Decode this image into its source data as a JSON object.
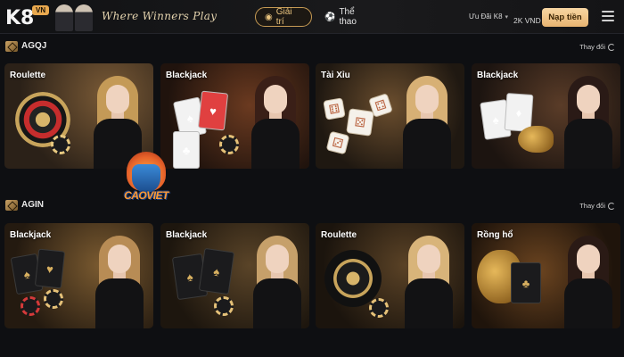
{
  "header": {
    "logo_text": "K8",
    "logo_badge": "VN",
    "slogan": "Where Winners Play",
    "nav": [
      {
        "label": "Giải trí",
        "icon": "gamepad-icon",
        "active": true
      },
      {
        "label": "Thể thao",
        "icon": "soccer-ball-icon",
        "active": false
      }
    ],
    "promo_label": "Ưu Đãi K8",
    "balance": "2K VND",
    "deposit_label": "Nạp tiền"
  },
  "sections": [
    {
      "title": "AGQJ",
      "change_label": "Thay đổi",
      "games": [
        {
          "label": "Roulette"
        },
        {
          "label": "Blackjack"
        },
        {
          "label": "Tài Xỉu"
        },
        {
          "label": "Blackjack"
        }
      ]
    },
    {
      "title": "AGIN",
      "change_label": "Thay đổi",
      "games": [
        {
          "label": "Blackjack"
        },
        {
          "label": "Blackjack"
        },
        {
          "label": "Roulette"
        },
        {
          "label": "Rồng hổ"
        }
      ]
    }
  ],
  "watermark_text": "CAOVIET",
  "colors": {
    "accent_gold": "#e8b471",
    "background": "#0e0f12"
  }
}
